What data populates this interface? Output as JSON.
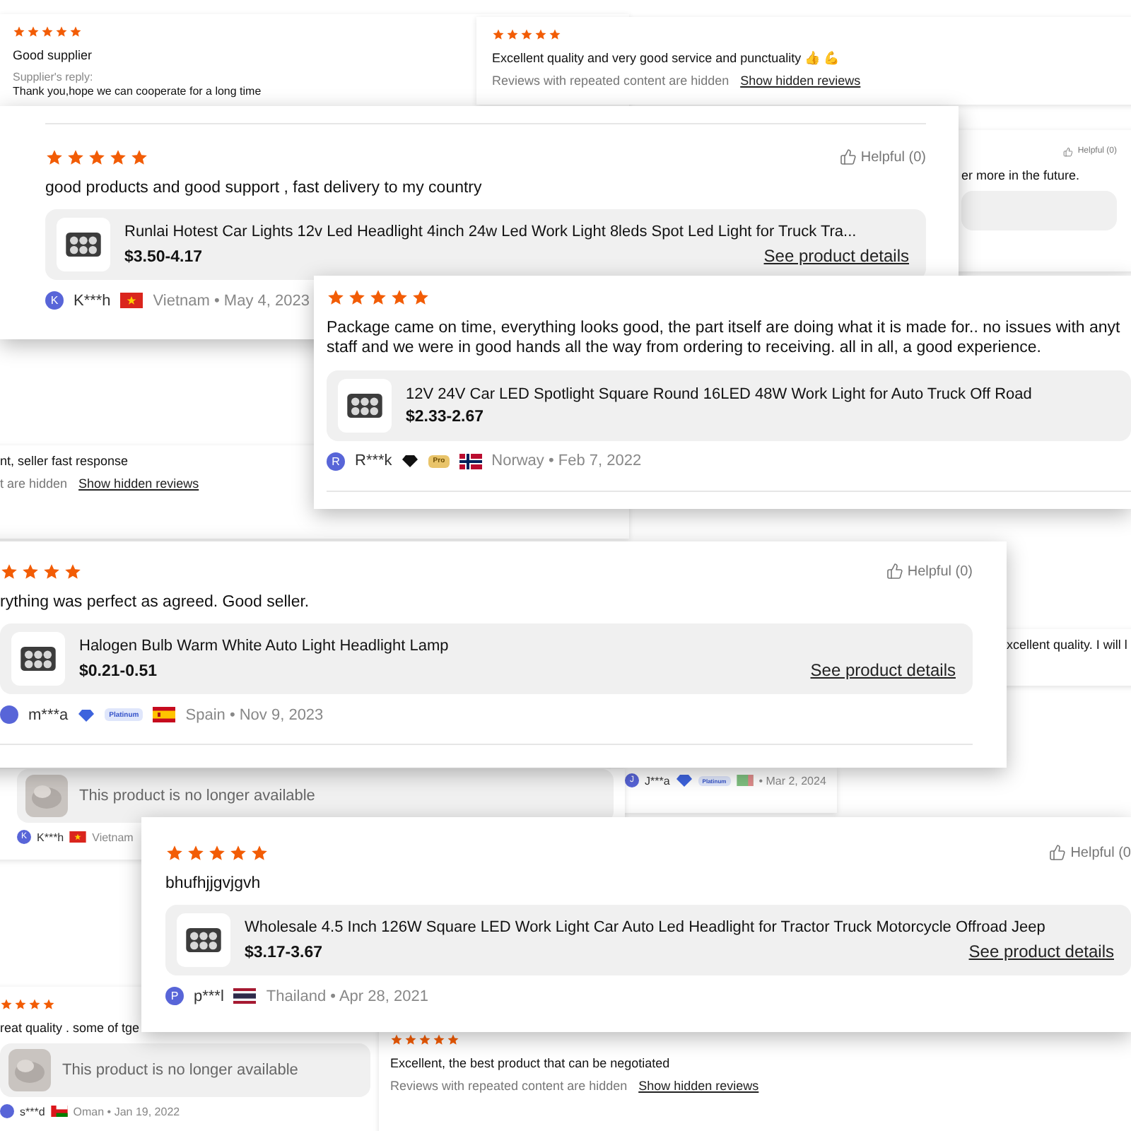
{
  "cards": [
    {
      "stars": 5,
      "text": "Good supplier",
      "reply_label": "Supplier's reply:",
      "reply_text": "Thank you,hope we can cooperate for a long time"
    },
    {
      "stars": 5,
      "text": "Excellent quality and very good service and punctuality 👍 💪",
      "hidden_notice": "Reviews with repeated content are hidden",
      "hidden_link": "Show hidden reviews"
    },
    {
      "helpful": "Helpful (0)",
      "text": "er more in the future.",
      "product": {
        "kind": "blank"
      }
    },
    {
      "text": "nt, seller fast response",
      "hidden_notice": "t are hidden",
      "hidden_link": "Show hidden reviews"
    },
    {
      "text": "xcellent quality. I will l"
    },
    {
      "reviewer": {
        "initial": "J",
        "name": "J***a",
        "badge": {
          "kind": "platinum",
          "label": "Platinum"
        },
        "location": "• Mar 2, 2024"
      }
    },
    {
      "product": {
        "kind": "unavailable",
        "title": "This product is no longer available"
      },
      "reviewer": {
        "initial": "K",
        "name": "K***h",
        "location": "Vietnam"
      }
    },
    {
      "stars": 4,
      "text": "reat quality . some of tge",
      "product": {
        "kind": "unavailable",
        "title": "This product is no longer available"
      },
      "reviewer": {
        "name": "s***d",
        "location": "Oman • Jan 19, 2022"
      }
    },
    {
      "stars": 5,
      "text": "Excellent, the best product that can be negotiated",
      "hidden_notice": "Reviews with repeated content are hidden",
      "hidden_link": "Show hidden reviews"
    },
    {
      "stars": 5,
      "helpful": "Helpful (0)",
      "text": "good products and good support , fast delivery to my country",
      "product": {
        "kind": "item",
        "title": "Runlai Hotest Car Lights 12v Led Headlight 4inch 24w Led Work Light 8leds Spot Led Light for Truck Tra...",
        "price": "$3.50-4.17",
        "details": "See product details"
      },
      "reviewer": {
        "initial": "K",
        "name": "K***h",
        "location": "Vietnam • May 4, 2023"
      }
    },
    {
      "stars": 5,
      "lines": [
        "Package came on time, everything looks good, the part itself are doing what it is made for.. no issues with anyt",
        "staff and we were in good hands all the way from ordering to receiving. all in all, a good experience."
      ],
      "product": {
        "kind": "item",
        "title": "12V 24V Car LED Spotlight Square Round 16LED 48W Work Light for Auto Truck Off Road",
        "price": "$2.33-2.67"
      },
      "reviewer": {
        "initial": "R",
        "name": "R***k",
        "badge": {
          "kind": "pro",
          "label": "Pro"
        },
        "location": "Norway • Feb 7, 2022"
      }
    },
    {
      "stars": 4,
      "helpful": "Helpful (0)",
      "text": "rything was perfect as agreed. Good seller.",
      "product": {
        "kind": "item",
        "title": "Halogen Bulb Warm White Auto Light Headlight Lamp",
        "price": "$0.21-0.51",
        "details": "See product details"
      },
      "reviewer": {
        "name": "m***a",
        "badge": {
          "kind": "platinum",
          "label": "Platinum"
        },
        "location": "Spain • Nov 9, 2023"
      }
    },
    {
      "stars": 5,
      "helpful": "Helpful (0",
      "text": "bhufhjjgvjgvh",
      "product": {
        "kind": "item",
        "title": "Wholesale 4.5 Inch 126W Square LED Work Light Car Auto Led Headlight for Tractor Truck Motorcycle Offroad Jeep",
        "price": "$3.17-3.67",
        "details": "See product details"
      },
      "reviewer": {
        "initial": "P",
        "name": "p***l",
        "location": "Thailand • Apr 28, 2021"
      }
    }
  ]
}
